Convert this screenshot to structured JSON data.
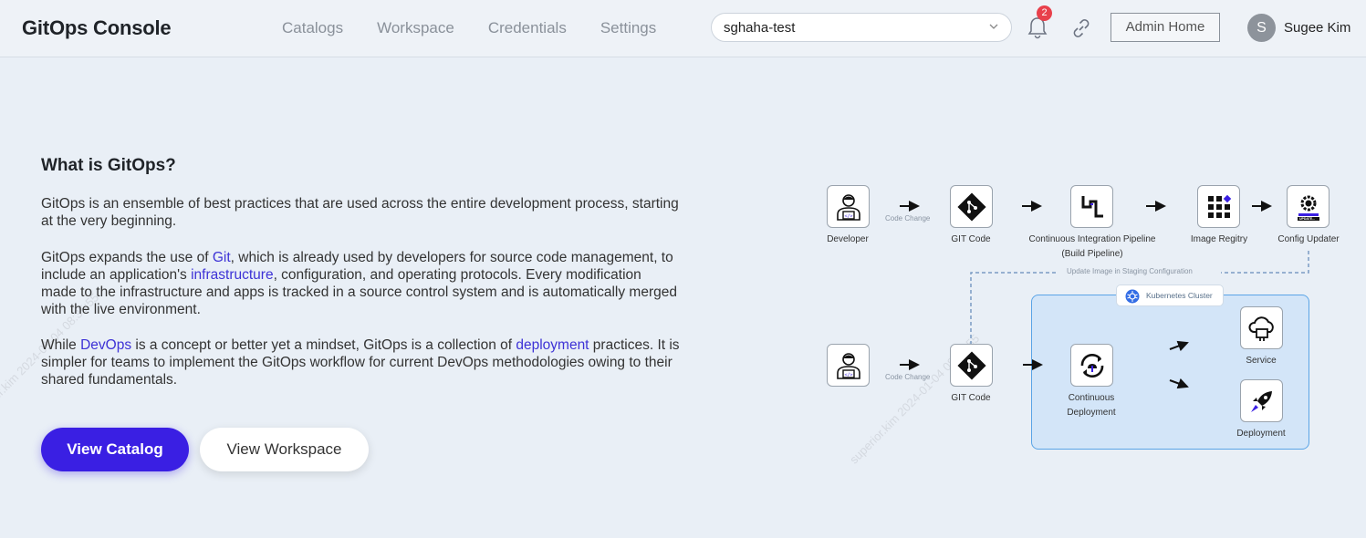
{
  "header": {
    "brand": "GitOps Console",
    "nav": [
      "Catalogs",
      "Workspace",
      "Credentials",
      "Settings"
    ],
    "project_select": "sghaha-test",
    "notification_count": "2",
    "admin_button": "Admin Home",
    "user_initial": "S",
    "user_name": "Sugee Kim"
  },
  "content": {
    "title": "What is GitOps?",
    "p1": "GitOps is an ensemble of best practices that are used across the entire development process, starting at the very beginning.",
    "p2_a": "GitOps expands the use of ",
    "p2_git": "Git",
    "p2_b": ", which is already used by developers for source code management, to include an application's ",
    "p2_infra": "infrastructure",
    "p2_c": ", configuration, and operating protocols. Every modification made to the infrastructure and apps is tracked in a source control system and is automatically merged with the live environment.",
    "p3_a": "While ",
    "p3_devops": "DevOps",
    "p3_b": " is a concept or better yet a mindset, GitOps is a collection of ",
    "p3_deploy": "deployment",
    "p3_c": " practices. It is simpler for teams to implement the GitOps workflow for current DevOps methodologies owing to their shared fundamentals.",
    "view_catalog": "View Catalog",
    "view_workspace": "View Workspace"
  },
  "diagram": {
    "developer": "Developer",
    "code_change": "Code Change",
    "git_code": "GIT Code",
    "ci_line1": "Continuous Integration Pipeline",
    "ci_line2": "(Build Pipeline)",
    "image_registry": "Image Regitry",
    "config_updater": "Config Updater",
    "updater_caption": "UPDATE...",
    "update_image": "Update Image in Staging Configuration",
    "k8s_cluster": "Kubernetes Cluster",
    "cd_line1": "Continuous",
    "cd_line2": "Deployment",
    "service": "Service",
    "deployment": "Deployment"
  },
  "watermark": "superior.kim 2024-01-04 08:35:55",
  "colors": {
    "primary": "#3a1fe3",
    "link": "#3d32d6",
    "badge": "#e8404b",
    "cluster_fill": "#d3e5f8",
    "cluster_border": "#5aa4e6"
  }
}
